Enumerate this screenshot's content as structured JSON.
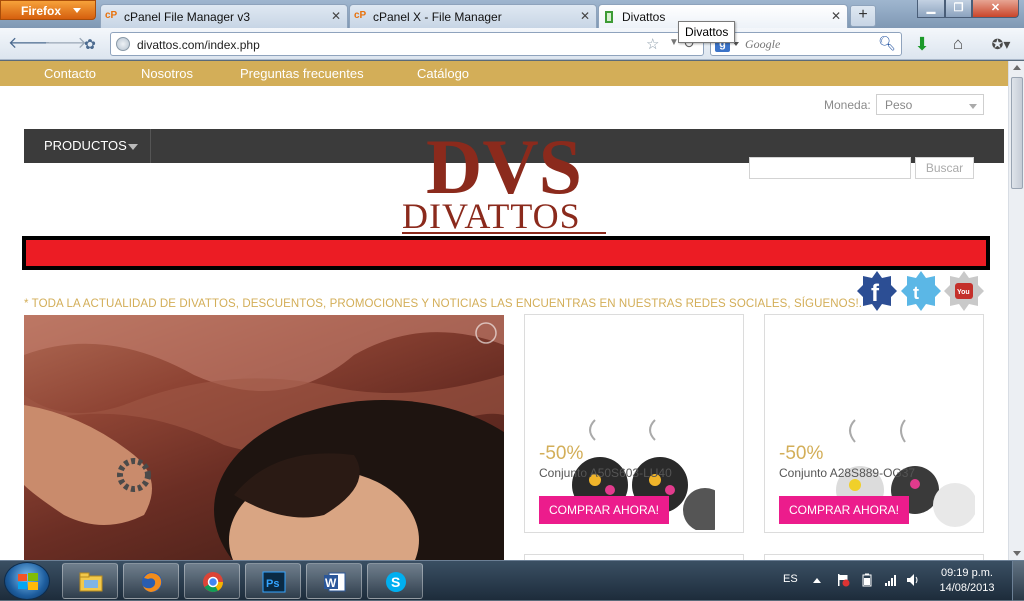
{
  "browser": {
    "menu_label": "Firefox",
    "tabs": [
      {
        "favicon": "cP",
        "title": "cPanel File Manager v3"
      },
      {
        "favicon": "cP",
        "title": "cPanel X - File Manager"
      },
      {
        "favicon": "divattos-icon",
        "title": "Divattos"
      }
    ],
    "url": "divattos.com/index.php",
    "search_engine": "Google",
    "search_placeholder": "Google",
    "tooltip": "Divattos"
  },
  "site": {
    "nav": [
      "Contacto",
      "Nosotros",
      "Preguntas frecuentes",
      "Catálogo"
    ],
    "currency_label": "Moneda:",
    "currency_value": "Peso",
    "products_menu": "PRODUCTOS",
    "logo_text": "DIVATTOS",
    "logo_monogram": "DVS",
    "search_button": "Buscar",
    "notice": "* TODA LA ACTUALIDAD DE DIVATTOS, DESCUENTOS, PROMOCIONES Y NOTICIAS LAS ENCUENTRAS EN NUESTRAS REDES SOCIALES, SÍGUENOS!.",
    "social": [
      "facebook",
      "twitter",
      "youtube"
    ],
    "products": [
      {
        "discount": "-50%",
        "name": "Conjunto A50S603-LU40",
        "cta": "COMPRAR AHORA!"
      },
      {
        "discount": "-50%",
        "name": "Conjunto A28S889-OG37",
        "cta": "COMPRAR AHORA!"
      }
    ]
  },
  "taskbar": {
    "apps": [
      "Windows Explorer",
      "Firefox",
      "Chrome",
      "Photoshop",
      "Word",
      "Skype"
    ],
    "language": "ES",
    "time": "09:19 p.m.",
    "date": "14/08/2013"
  },
  "colors": {
    "nav_gold": "#d3ae58",
    "accent_red": "#ec1c24",
    "button_pink": "#ec1c8c",
    "logo_brown": "#8b2a1c"
  }
}
